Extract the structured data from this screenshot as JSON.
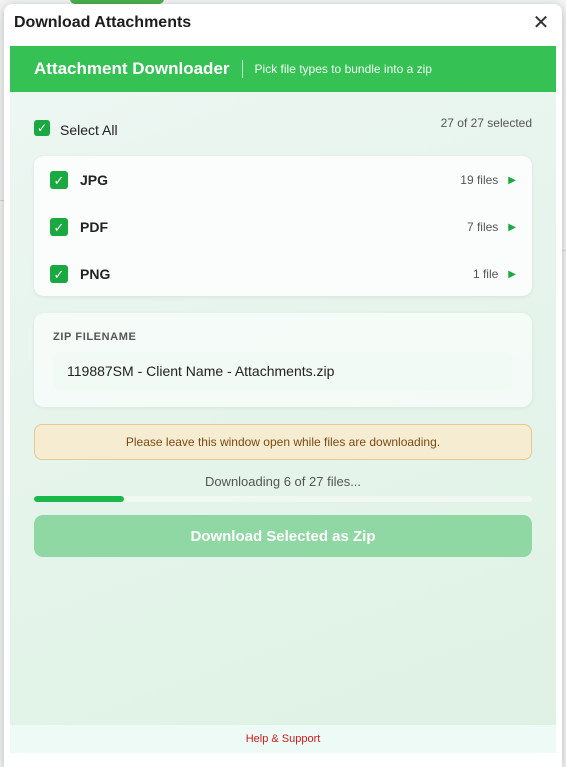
{
  "dialog": {
    "title": "Download Attachments",
    "close_glyph": "✕"
  },
  "banner": {
    "title": "Attachment Downloader",
    "subtitle": "Pick file types to bundle into a zip"
  },
  "selection": {
    "select_all_label": "Select All",
    "select_all_checked": true,
    "count_text": "27 of 27 selected"
  },
  "file_types": [
    {
      "label": "JPG",
      "count_text": "19 files",
      "checked": true
    },
    {
      "label": "PDF",
      "count_text": "7 files",
      "checked": true
    },
    {
      "label": "PNG",
      "count_text": "1 file",
      "checked": true
    }
  ],
  "zip": {
    "label": "ZIP FILENAME",
    "value": "119887SM - Client Name - Attachments.zip"
  },
  "warning": "Please leave this window open while files are downloading.",
  "progress": {
    "text": "Downloading 6 of 27 files...",
    "fraction": 0.18
  },
  "download_button": "Download Selected as Zip",
  "footer": {
    "help_link": "Help & Support"
  },
  "colors": {
    "accent": "#36c155",
    "check": "#1aa841",
    "button_disabled": "#8fd8a3",
    "warning_bg": "#f6ecd2",
    "help_link": "#d11b1b"
  },
  "icons": {
    "checkbox": "check-icon",
    "expand": "play-triangle-icon",
    "close": "close-icon"
  }
}
